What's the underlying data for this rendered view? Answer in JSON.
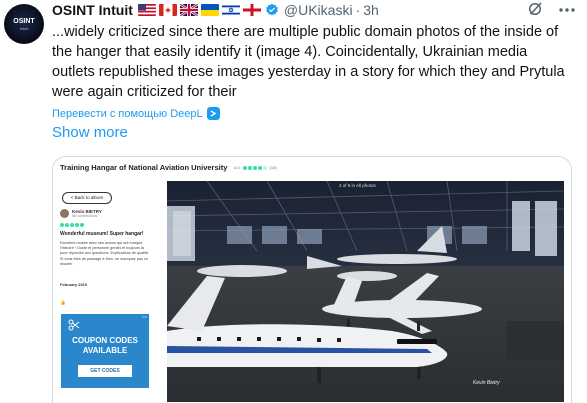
{
  "author": {
    "name": "OSINT Intuit",
    "handle": "@UKikaski",
    "separator": "·",
    "time": "3h",
    "avatar_text": "OSINT",
    "avatar_subtext": "intuit"
  },
  "flags": [
    "us-flag",
    "canada-flag",
    "uk-flag",
    "ukraine-flag",
    "israel-flag",
    "england-flag"
  ],
  "tweet": {
    "text": "...widely criticized since there are multiple public domain photos of the inside of the hanger that easily identify it (image 4). Coincidentally, Ukrainian media outlets republished these images yesterday in a story for which they and Prytula were again criticized for their",
    "translate_label": "Перевести с помощью DeepL",
    "show_more": "Show more"
  },
  "media": {
    "page_title": "Training Hangar of National Aviation University",
    "rating_score": "4.0",
    "rating_count": "(10)",
    "back_button": "< Back to album",
    "photo_count": "2 of 9 in All photos",
    "review": {
      "reviewer_name": "Kevin BIETRY",
      "reviewer_contrib": "No contributions",
      "title": "Wonderful museum! Super hangar!",
      "body": "Excellent musée avec ses avions qui ont marqué l'histoire ! Guide et personnel gentils et toujours là pour répondre aux questions. Explications de qualité. Si vous êtes de passage à Kiev, ne manquez pas ce musée!",
      "date": "February 2019",
      "likes": "👍"
    },
    "coupon": {
      "ad_mark": "▷×",
      "title_line1": "COUPON CODES",
      "title_line2": "AVAILABLE",
      "button": "GET CODES"
    },
    "watermark": "Kevin Bietry"
  },
  "colors": {
    "accent": "#1d9bf0",
    "text": "#0f1419",
    "muted": "#536471",
    "tripadvisor_green": "#34e0a1",
    "coupon_blue": "#2a87cc"
  }
}
